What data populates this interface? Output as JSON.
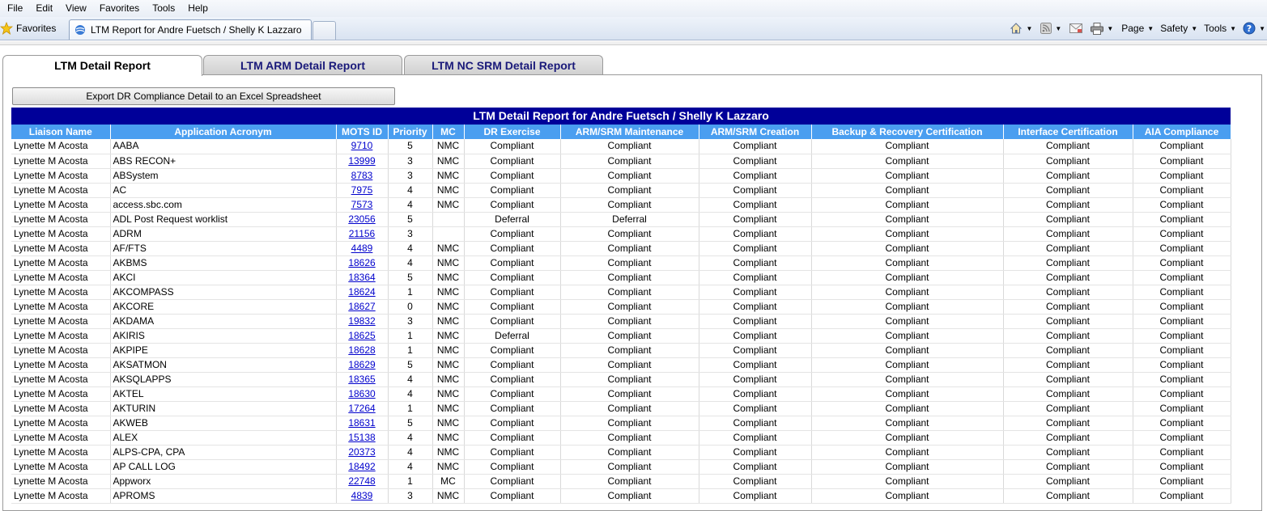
{
  "menu": [
    "File",
    "Edit",
    "View",
    "Favorites",
    "Tools",
    "Help"
  ],
  "favorites_label": "Favorites",
  "browser_tab_title": "LTM Report for Andre Fuetsch / Shelly K Lazzaro",
  "command_bar": {
    "page": "Page",
    "safety": "Safety",
    "tools": "Tools"
  },
  "page_tabs": [
    "LTM Detail Report",
    "LTM ARM Detail Report",
    "LTM NC SRM Detail Report"
  ],
  "export_button": "Export DR Compliance Detail to an Excel Spreadsheet",
  "report_title": "LTM Detail Report for Andre Fuetsch / Shelly K Lazzaro",
  "columns": [
    "Liaison Name",
    "Application Acronym",
    "MOTS ID",
    "Priority",
    "MC",
    "DR Exercise",
    "ARM/SRM Maintenance",
    "ARM/SRM Creation",
    "Backup & Recovery Certification",
    "Interface Certification",
    "AIA Compliance"
  ],
  "rows": [
    [
      "Lynette M Acosta",
      "AABA",
      "9710",
      "5",
      "NMC",
      "Compliant",
      "Compliant",
      "Compliant",
      "Compliant",
      "Compliant",
      "Compliant"
    ],
    [
      "Lynette M Acosta",
      "ABS RECON+",
      "13999",
      "3",
      "NMC",
      "Compliant",
      "Compliant",
      "Compliant",
      "Compliant",
      "Compliant",
      "Compliant"
    ],
    [
      "Lynette M Acosta",
      "ABSystem",
      "8783",
      "3",
      "NMC",
      "Compliant",
      "Compliant",
      "Compliant",
      "Compliant",
      "Compliant",
      "Compliant"
    ],
    [
      "Lynette M Acosta",
      "AC",
      "7975",
      "4",
      "NMC",
      "Compliant",
      "Compliant",
      "Compliant",
      "Compliant",
      "Compliant",
      "Compliant"
    ],
    [
      "Lynette M Acosta",
      "access.sbc.com",
      "7573",
      "4",
      "NMC",
      "Compliant",
      "Compliant",
      "Compliant",
      "Compliant",
      "Compliant",
      "Compliant"
    ],
    [
      "Lynette M Acosta",
      "ADL Post Request worklist",
      "23056",
      "5",
      "",
      "Deferral",
      "Deferral",
      "Compliant",
      "Compliant",
      "Compliant",
      "Compliant"
    ],
    [
      "Lynette M Acosta",
      "ADRM",
      "21156",
      "3",
      "",
      "Compliant",
      "Compliant",
      "Compliant",
      "Compliant",
      "Compliant",
      "Compliant"
    ],
    [
      "Lynette M Acosta",
      "AF/FTS",
      "4489",
      "4",
      "NMC",
      "Compliant",
      "Compliant",
      "Compliant",
      "Compliant",
      "Compliant",
      "Compliant"
    ],
    [
      "Lynette M Acosta",
      "AKBMS",
      "18626",
      "4",
      "NMC",
      "Compliant",
      "Compliant",
      "Compliant",
      "Compliant",
      "Compliant",
      "Compliant"
    ],
    [
      "Lynette M Acosta",
      "AKCI",
      "18364",
      "5",
      "NMC",
      "Compliant",
      "Compliant",
      "Compliant",
      "Compliant",
      "Compliant",
      "Compliant"
    ],
    [
      "Lynette M Acosta",
      "AKCOMPASS",
      "18624",
      "1",
      "NMC",
      "Compliant",
      "Compliant",
      "Compliant",
      "Compliant",
      "Compliant",
      "Compliant"
    ],
    [
      "Lynette M Acosta",
      "AKCORE",
      "18627",
      "0",
      "NMC",
      "Compliant",
      "Compliant",
      "Compliant",
      "Compliant",
      "Compliant",
      "Compliant"
    ],
    [
      "Lynette M Acosta",
      "AKDAMA",
      "19832",
      "3",
      "NMC",
      "Compliant",
      "Compliant",
      "Compliant",
      "Compliant",
      "Compliant",
      "Compliant"
    ],
    [
      "Lynette M Acosta",
      "AKIRIS",
      "18625",
      "1",
      "NMC",
      "Deferral",
      "Compliant",
      "Compliant",
      "Compliant",
      "Compliant",
      "Compliant"
    ],
    [
      "Lynette M Acosta",
      "AKPIPE",
      "18628",
      "1",
      "NMC",
      "Compliant",
      "Compliant",
      "Compliant",
      "Compliant",
      "Compliant",
      "Compliant"
    ],
    [
      "Lynette M Acosta",
      "AKSATMON",
      "18629",
      "5",
      "NMC",
      "Compliant",
      "Compliant",
      "Compliant",
      "Compliant",
      "Compliant",
      "Compliant"
    ],
    [
      "Lynette M Acosta",
      "AKSQLAPPS",
      "18365",
      "4",
      "NMC",
      "Compliant",
      "Compliant",
      "Compliant",
      "Compliant",
      "Compliant",
      "Compliant"
    ],
    [
      "Lynette M Acosta",
      "AKTEL",
      "18630",
      "4",
      "NMC",
      "Compliant",
      "Compliant",
      "Compliant",
      "Compliant",
      "Compliant",
      "Compliant"
    ],
    [
      "Lynette M Acosta",
      "AKTURIN",
      "17264",
      "1",
      "NMC",
      "Compliant",
      "Compliant",
      "Compliant",
      "Compliant",
      "Compliant",
      "Compliant"
    ],
    [
      "Lynette M Acosta",
      "AKWEB",
      "18631",
      "5",
      "NMC",
      "Compliant",
      "Compliant",
      "Compliant",
      "Compliant",
      "Compliant",
      "Compliant"
    ],
    [
      "Lynette M Acosta",
      "ALEX",
      "15138",
      "4",
      "NMC",
      "Compliant",
      "Compliant",
      "Compliant",
      "Compliant",
      "Compliant",
      "Compliant"
    ],
    [
      "Lynette M Acosta",
      "ALPS-CPA, CPA",
      "20373",
      "4",
      "NMC",
      "Compliant",
      "Compliant",
      "Compliant",
      "Compliant",
      "Compliant",
      "Compliant"
    ],
    [
      "Lynette M Acosta",
      "AP CALL LOG",
      "18492",
      "4",
      "NMC",
      "Compliant",
      "Compliant",
      "Compliant",
      "Compliant",
      "Compliant",
      "Compliant"
    ],
    [
      "Lynette M Acosta",
      "Appworx",
      "22748",
      "1",
      "MC",
      "Compliant",
      "Compliant",
      "Compliant",
      "Compliant",
      "Compliant",
      "Compliant"
    ],
    [
      "Lynette M Acosta",
      "APROMS",
      "4839",
      "3",
      "NMC",
      "Compliant",
      "Compliant",
      "Compliant",
      "Compliant",
      "Compliant",
      "Compliant"
    ]
  ]
}
